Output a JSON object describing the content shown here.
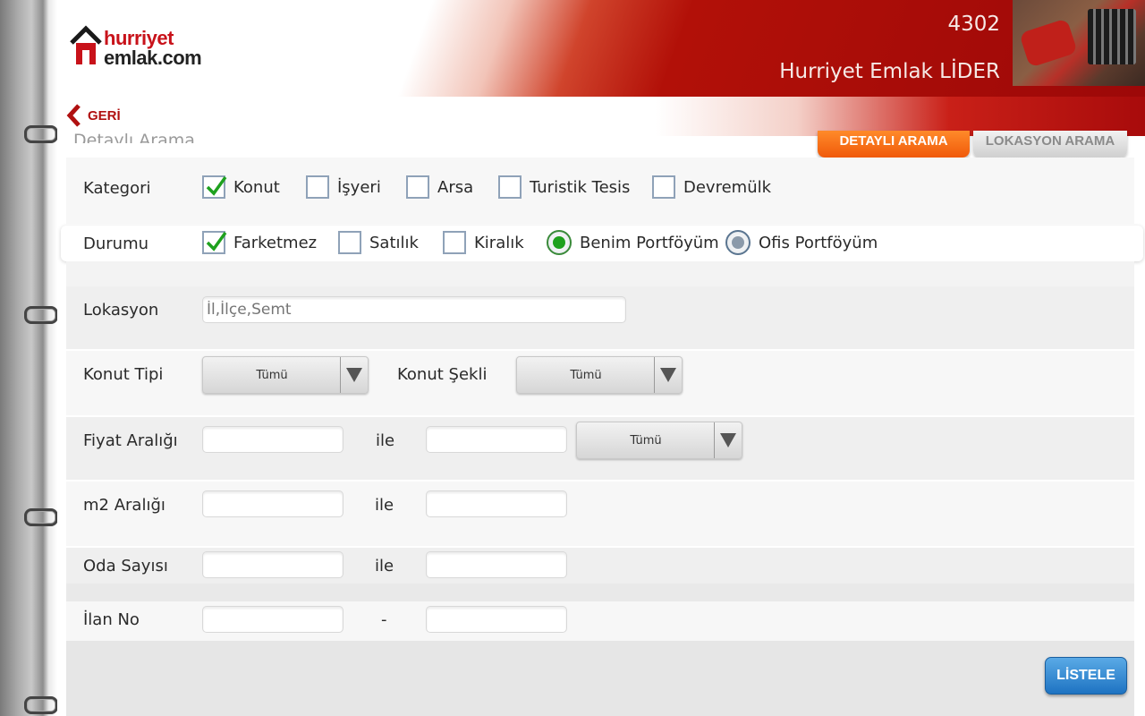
{
  "header": {
    "logo_line1": "hurriyet",
    "logo_line2": "emlak.com",
    "count": "4302",
    "user": "Hurriyet Emlak LİDER"
  },
  "back_label": "GERİ",
  "section_title": "Detaylı Arama",
  "tabs": [
    {
      "label": "DETAYLI ARAMA",
      "active": true
    },
    {
      "label": "LOKASYON ARAMA",
      "active": false
    }
  ],
  "kategori": {
    "label": "Kategori",
    "options": [
      {
        "label": "Konut",
        "checked": true
      },
      {
        "label": "İşyeri",
        "checked": false
      },
      {
        "label": "Arsa",
        "checked": false
      },
      {
        "label": "Turistik Tesis",
        "checked": false
      },
      {
        "label": "Devremülk",
        "checked": false
      }
    ]
  },
  "durumu": {
    "label": "Durumu",
    "checkboxes": [
      {
        "label": "Farketmez",
        "checked": true
      },
      {
        "label": "Satılık",
        "checked": false
      },
      {
        "label": "Kiralık",
        "checked": false
      }
    ],
    "radios": [
      {
        "label": "Benim Portföyüm",
        "selected": true
      },
      {
        "label": "Ofis Portföyüm",
        "selected": false
      }
    ]
  },
  "lokasyon": {
    "label": "Lokasyon",
    "placeholder": "İl,İlçe,Semt"
  },
  "konut_tipi": {
    "label": "Konut Tipi",
    "value": "Tümü"
  },
  "konut_sekli": {
    "label": "Konut Şekli",
    "value": "Tümü"
  },
  "fiyat": {
    "label": "Fiyat Aralığı",
    "separator": "ile",
    "currency": "Tümü"
  },
  "m2": {
    "label": "m2 Aralığı",
    "separator": "ile"
  },
  "oda": {
    "label": "Oda Sayısı",
    "separator": "ile"
  },
  "ilan": {
    "label": "İlan No",
    "separator": "-"
  },
  "listele_label": "LİSTELE",
  "colors": {
    "accent_orange": "#f05a0a",
    "brand_red": "#b01010",
    "button_blue": "#1e73c2",
    "check_green": "#1ea11e"
  }
}
